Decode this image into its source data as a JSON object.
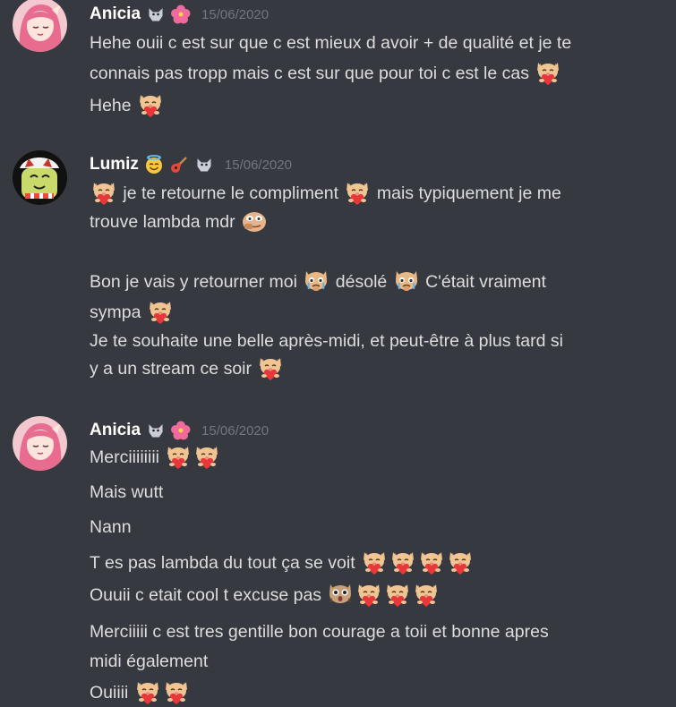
{
  "colors": {
    "background": "#36393f",
    "text": "#dcddde",
    "username": "#ffffff",
    "timestamp": "#72767d"
  },
  "groups": [
    {
      "username": "Anicia",
      "badges": [
        "wolf-icon",
        "hibiscus-icon"
      ],
      "timestamp": "15/06/2020",
      "avatar": "pink-hair-avatar",
      "lines": [
        {
          "text": "Hehe ouii c est sur que c est mieux d avoir + de qualité et je te"
        },
        {
          "text": "connais pas tropp mais c est sur que pour toi c est le cas",
          "emojis": [
            "cat-heart-emoji"
          ]
        },
        {
          "text": "Hehe",
          "emojis": [
            "cat-heart-emoji"
          ]
        }
      ]
    },
    {
      "username": "Lumiz",
      "badges": [
        "angel-smile-icon",
        "guitar-icon",
        "wolf-icon"
      ],
      "timestamp": "15/06/2020",
      "avatar": "green-character-avatar",
      "lines": [
        {
          "pre": [
            "cat-heart-emoji"
          ],
          "text": "je te retourne le compliment",
          "mid": [
            "cat-heart-emoji"
          ],
          "text2": "mais typiquement je me"
        },
        {
          "text": "trouve lambda mdr",
          "emojis": [
            "pepe-emoji"
          ]
        },
        {
          "text": "Bon je vais y retourner moi",
          "mid": [
            "crying-cat-emoji"
          ],
          "text2": "désolé",
          "mid2": [
            "crying-cat-emoji"
          ],
          "text3": "C'était vraiment"
        },
        {
          "text": "sympa",
          "emojis": [
            "cat-heart-emoji"
          ]
        },
        {
          "text": "Je te souhaite une belle après-midi, et peut-être à plus tard si"
        },
        {
          "text": "y a un stream ce soir",
          "emojis": [
            "cat-heart-emoji"
          ]
        }
      ]
    },
    {
      "username": "Anicia",
      "badges": [
        "wolf-icon",
        "hibiscus-icon"
      ],
      "timestamp": "15/06/2020",
      "avatar": "pink-hair-avatar",
      "lines": [
        {
          "text": "Merciiiiiiii",
          "emojis": [
            "cat-heart-emoji",
            "cat-heart-emoji"
          ]
        },
        {
          "text": "Mais wutt"
        },
        {
          "text": "Nann"
        },
        {
          "text": "T es pas lambda du tout ça se voit",
          "emojis": [
            "cat-heart-emoji",
            "cat-heart-emoji",
            "cat-heart-emoji",
            "cat-heart-emoji"
          ]
        },
        {
          "text": "Ouuii c etait cool t excuse pas",
          "emojis": [
            "shocked-cat-emoji",
            "cat-heart-emoji",
            "cat-heart-emoji",
            "cat-heart-emoji"
          ]
        },
        {
          "text": "Merciiiii c est tres gentille bon courage a toii et bonne apres"
        },
        {
          "text": "midi également"
        },
        {
          "text": "Ouiiii",
          "emojis": [
            "cat-heart-emoji",
            "cat-heart-emoji"
          ]
        }
      ]
    }
  ]
}
